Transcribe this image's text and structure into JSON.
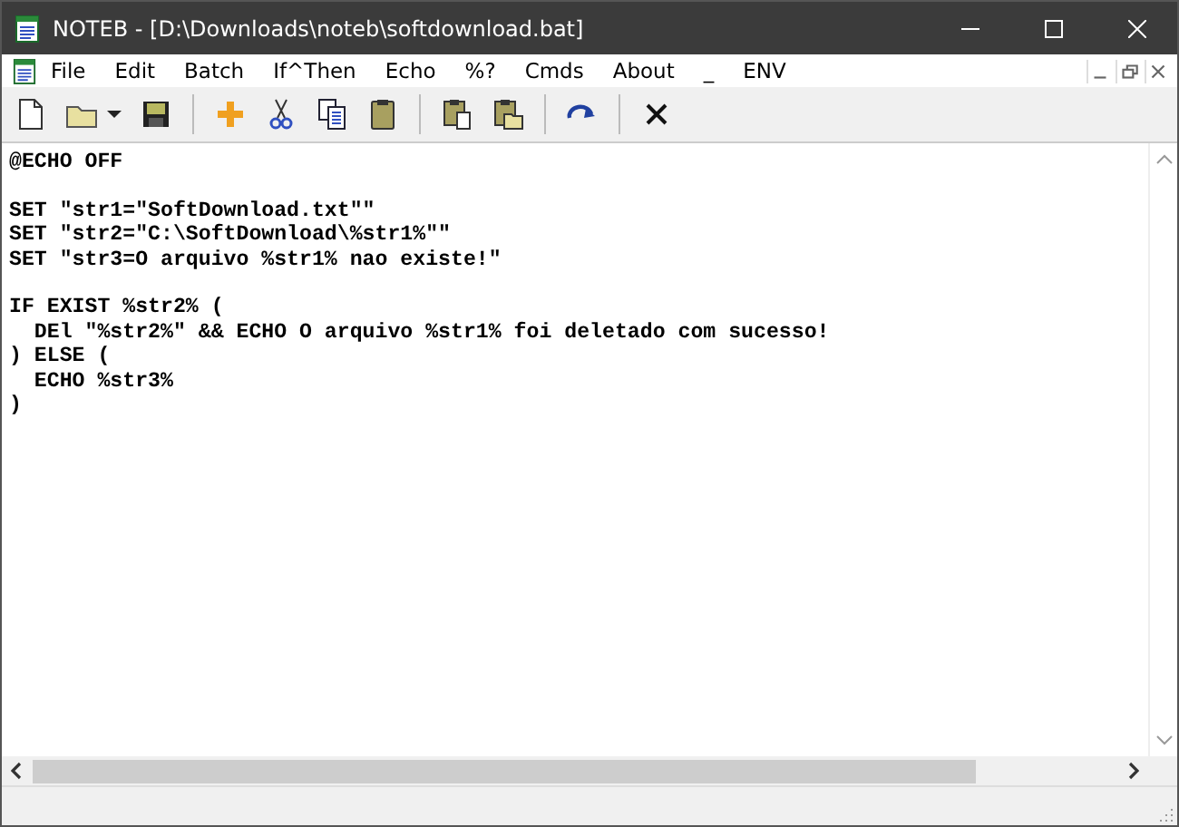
{
  "window": {
    "title": "NOTEB - [D:\\Downloads\\noteb\\softdownload.bat]"
  },
  "menu": [
    "File",
    "Edit",
    "Batch",
    "If^Then",
    "Echo",
    "%?",
    "Cmds",
    "About",
    "_",
    "ENV"
  ],
  "toolbar": [
    {
      "kind": "new"
    },
    {
      "kind": "open"
    },
    {
      "kind": "dropdown"
    },
    {
      "kind": "save"
    },
    {
      "kind": "sep"
    },
    {
      "kind": "add"
    },
    {
      "kind": "cut"
    },
    {
      "kind": "copy"
    },
    {
      "kind": "paste"
    },
    {
      "kind": "sep"
    },
    {
      "kind": "paste-doc"
    },
    {
      "kind": "paste-folder"
    },
    {
      "kind": "sep"
    },
    {
      "kind": "redo"
    },
    {
      "kind": "sep"
    },
    {
      "kind": "delete"
    }
  ],
  "editor": {
    "blocks": [
      [
        "@ECHO OFF"
      ],
      [
        "SET \"str1=\"SoftDownload.txt\"\"",
        "SET \"str2=\"C:\\SoftDownload\\%str1%\"\"",
        "SET \"str3=O arquivo %str1% nao existe!\""
      ],
      [
        "IF EXIST %str2% (",
        "  DEl \"%str2%\" && ECHO O arquivo %str1% foi deletado com sucesso!",
        ") ELSE (",
        "  ECHO %str3%",
        ")"
      ]
    ]
  }
}
